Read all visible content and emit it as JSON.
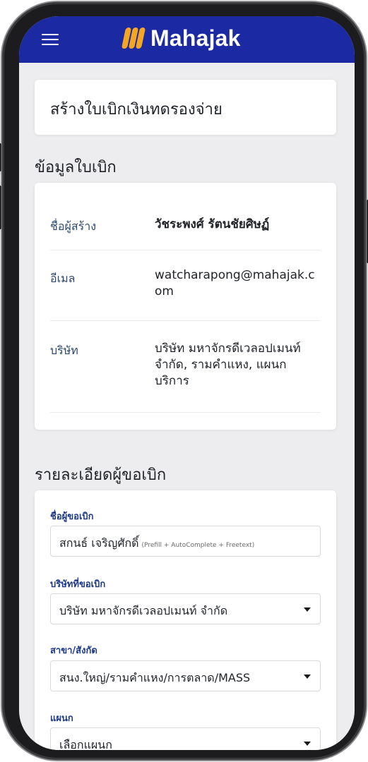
{
  "app": {
    "brand": "Mahajak",
    "colors": {
      "header": "#1b2aa3",
      "logo_mark": "#f5a623",
      "label": "#2c4770",
      "field_label": "#1d3a8a"
    }
  },
  "page": {
    "title": "สร้างใบเบิกเงินทดรองจ่าย"
  },
  "info_section": {
    "heading": "ข้อมูลใบเบิก",
    "rows": [
      {
        "label": "ชื่อผู้สร้าง",
        "value": "วัชระพงศ์ รัตนชัยศิษฏ์"
      },
      {
        "label": "อีเมล",
        "value": "watcharapong@mahajak.com"
      },
      {
        "label": "บริษัท",
        "value": "บริษัท มหาจักรดีเวลอปเมนท์ จำกัด, รามคำแหง, แผนก บริการ"
      }
    ]
  },
  "requester_section": {
    "heading": "รายละเอียดผู้ขอเบิก",
    "fields": [
      {
        "label": "ชื่อผู้ขอเบิก",
        "value": "สกนธ์ เจริญศักดิ์",
        "hint": "(Prefill + AutoComplete + Freetext)"
      },
      {
        "label": "บริษัทที่ขอเบิก",
        "value": "บริษัท มหาจักรดีเวลอปเมนท์ จำกัด"
      },
      {
        "label": "สาขา/สังกัด",
        "value": "สนง.ใหญ่/รามคำแหง/การตลาด/MASS"
      },
      {
        "label": "แผนก",
        "value": "เลือกแผนก"
      }
    ]
  },
  "icons": [
    "menu-icon",
    "mahajak-logo-icon",
    "chevron-down-icon"
  ]
}
